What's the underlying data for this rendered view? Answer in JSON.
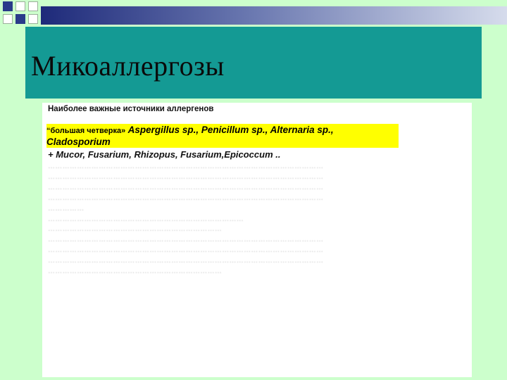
{
  "slide": {
    "title": "Микоаллергозы",
    "heading": "Наиболее важные источники аллергенов",
    "highlight": {
      "lead": "“большая четверка»",
      "genera_line1": "Aspergillus sp., Penicillum sp., Alternaria sp.,",
      "genera_line2": "Cladosporium"
    },
    "plus_line": "+ Mucor,  Fusarium,  Rhizopus,  Fusarium,Epicoccum ..",
    "body_lines": [
      "……………………………………………………………………………………………………",
      "……………………………………………………………………………………………………",
      "……………………………………………………………………………………………………",
      "……………………………………………………………………………………………………",
      "……………",
      "………………………………………………………………………",
      "………………………………………………………………",
      "……………………………………………………………………………………………………",
      "……………………………………………………………………………………………………",
      "……………………………………………………………………………………………………",
      "………………………………………………………………"
    ]
  },
  "colors": {
    "background": "#ccffcc",
    "title_bar": "#149a94",
    "highlight": "#ffff00",
    "content_panel": "#ffffff"
  }
}
